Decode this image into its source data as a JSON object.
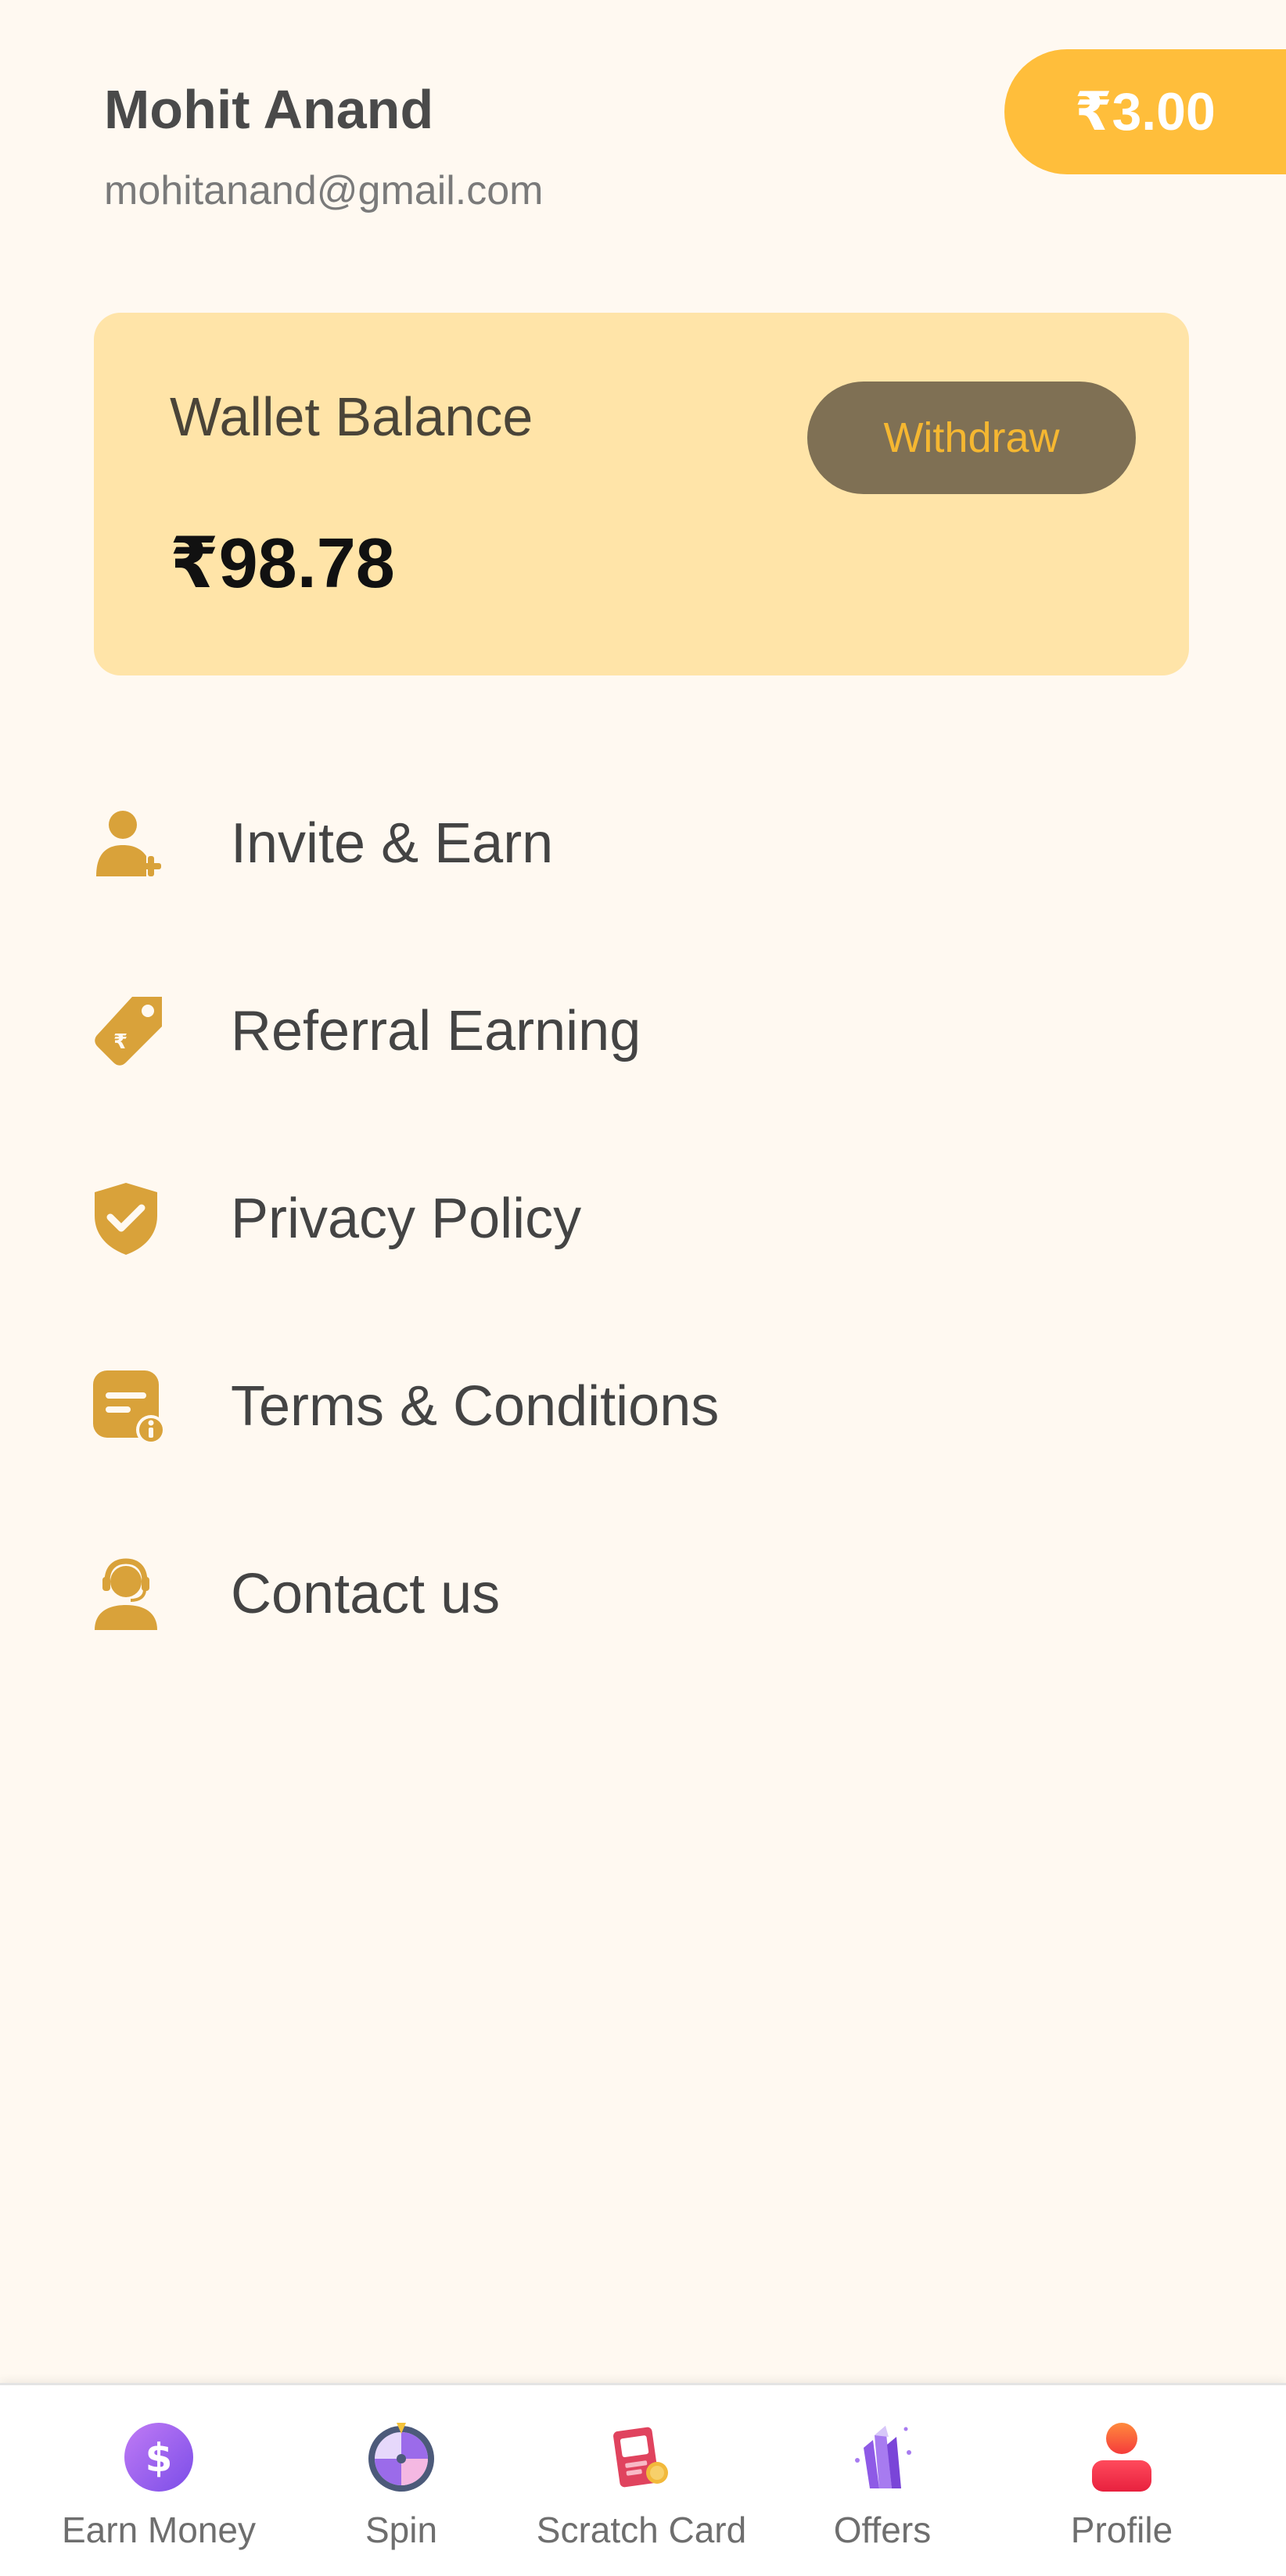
{
  "header": {
    "user_name": "Mohit Anand",
    "user_email": "mohitanand@gmail.com",
    "points_badge": "₹3.00"
  },
  "wallet": {
    "label": "Wallet Balance",
    "amount": "₹98.78",
    "withdraw_label": "Withdraw"
  },
  "menu": {
    "items": [
      {
        "label": "Invite & Earn",
        "icon": "add-user-icon"
      },
      {
        "label": "Referral Earning",
        "icon": "rupee-tag-icon"
      },
      {
        "label": "Privacy Policy",
        "icon": "shield-check-icon"
      },
      {
        "label": "Terms & Conditions",
        "icon": "document-info-icon"
      },
      {
        "label": "Contact us",
        "icon": "support-agent-icon"
      }
    ]
  },
  "bottom_nav": {
    "items": [
      {
        "label": "Earn Money",
        "icon": "dollar-coin-icon"
      },
      {
        "label": "Spin",
        "icon": "spin-wheel-icon"
      },
      {
        "label": "Scratch Card",
        "icon": "scratch-card-icon"
      },
      {
        "label": "Offers",
        "icon": "offers-crystal-icon"
      },
      {
        "label": "Profile",
        "icon": "profile-person-icon"
      }
    ],
    "active": "Profile"
  },
  "colors": {
    "background": "#FFF9F1",
    "accent": "#FFBE3B",
    "wallet_card": "#FFE4A8",
    "withdraw_button": "#7F7054",
    "menu_icon": "#D9A23A"
  }
}
